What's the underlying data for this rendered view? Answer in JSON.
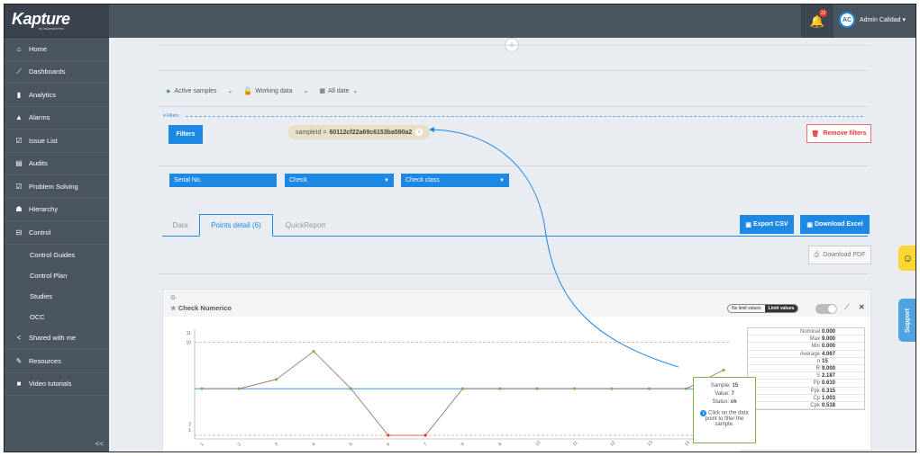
{
  "app": {
    "brand": "Kapture",
    "brand_sub": "by Iscanometric"
  },
  "sidebar": {
    "items": [
      {
        "label": "Home",
        "icon": "home-icon",
        "glyph": "⌂"
      },
      {
        "label": "Dashboards",
        "icon": "dashboards-icon",
        "glyph": "⟋"
      },
      {
        "label": "Analytics",
        "icon": "analytics-icon",
        "glyph": "▮"
      },
      {
        "label": "Alarms",
        "icon": "alarm-icon",
        "glyph": "▲"
      },
      {
        "label": "Issue List",
        "icon": "issue-icon",
        "glyph": "☑"
      },
      {
        "label": "Audits",
        "icon": "audits-icon",
        "glyph": "▤"
      },
      {
        "label": "Problem Solving",
        "icon": "problem-icon",
        "glyph": "☑"
      },
      {
        "label": "Hierarchy",
        "icon": "hierarchy-icon",
        "glyph": "☗"
      },
      {
        "label": "Control",
        "icon": "control-icon",
        "glyph": "⊟"
      }
    ],
    "subitems": [
      "Control Guides",
      "Control Plan",
      "Studies",
      "OCC"
    ],
    "items2": [
      {
        "label": "Shared with me",
        "icon": "share-icon",
        "glyph": "<"
      },
      {
        "label": "Resources",
        "icon": "resources-icon",
        "glyph": "✎"
      },
      {
        "label": "Video tutorials",
        "icon": "video-icon",
        "glyph": "■"
      }
    ],
    "collapse": "<<"
  },
  "topbar": {
    "notifications": "22",
    "avatar": "AC",
    "user": "Admin Calidad ▾"
  },
  "toolbar": {
    "active": "Active samples",
    "working": "Working data",
    "date": "All date"
  },
  "filters": {
    "label": "▾ Filters",
    "button": "Filters",
    "chip_key": "sampleId =",
    "chip_value": "60112cf22a69c6153ba590a2",
    "remove": "Remove filters"
  },
  "selects": [
    {
      "label": "Serial No.",
      "caret": ""
    },
    {
      "label": "Check",
      "caret": "▼"
    },
    {
      "label": "Check class",
      "caret": "▼"
    }
  ],
  "tabs": [
    "Data",
    "Points detail (6)",
    "QuickReport"
  ],
  "actions": {
    "export_csv": "Export CSV",
    "download_excel": "Download Excel",
    "download_pdf": "Download PDF"
  },
  "panel": {
    "title": "Check Numerico",
    "no_limit": "No limit values",
    "limit": "Limit values"
  },
  "stats": [
    {
      "k": "Nominal",
      "v": "0.000"
    },
    {
      "k": "Max",
      "v": "9.000"
    },
    {
      "k": "Min",
      "v": "0.000"
    },
    {
      "k": "Average",
      "v": "4.067"
    },
    {
      "k": "n",
      "v": "15"
    },
    {
      "k": "R",
      "v": "9.000"
    },
    {
      "k": "S",
      "v": "2.187"
    },
    {
      "k": "Pp",
      "v": "0.610"
    },
    {
      "k": "Ppk",
      "v": "0.315"
    },
    {
      "k": "Cp",
      "v": "1.003"
    },
    {
      "k": "Cpk",
      "v": "0.518"
    }
  ],
  "tooltip": {
    "sample_label": "Sample:",
    "sample": "15",
    "value_label": "Value:",
    "value": "7",
    "status_label": "Status:",
    "status": "ok",
    "hint": "Click on the data point to filter the sample."
  },
  "chart_data": {
    "type": "line",
    "x": [
      1,
      2,
      3,
      4,
      5,
      6,
      7,
      8,
      9,
      10,
      11,
      12,
      13,
      14,
      15
    ],
    "values": [
      5,
      5,
      6,
      9,
      5,
      0,
      0,
      5,
      5,
      5,
      5,
      5,
      5,
      5,
      7
    ],
    "y_ticks": [
      "11",
      "10",
      "2",
      "1"
    ],
    "x_ticks": [
      "1",
      "2",
      "3",
      "4",
      "5",
      "6",
      "7",
      "8",
      "9",
      "10",
      "11",
      "12",
      "13",
      "14"
    ],
    "upper_limit": 10,
    "lower_limit": 0,
    "nominal_line": 5,
    "ylim": [
      0,
      11
    ],
    "colors": {
      "line": "#8d6e63",
      "nominal": "#1e88e5",
      "limit": "#ef9a9a",
      "ok_point": "#7cb342",
      "bad_point": "#e53935"
    }
  },
  "widgets": {
    "support": "Support",
    "smiley": "☺"
  }
}
